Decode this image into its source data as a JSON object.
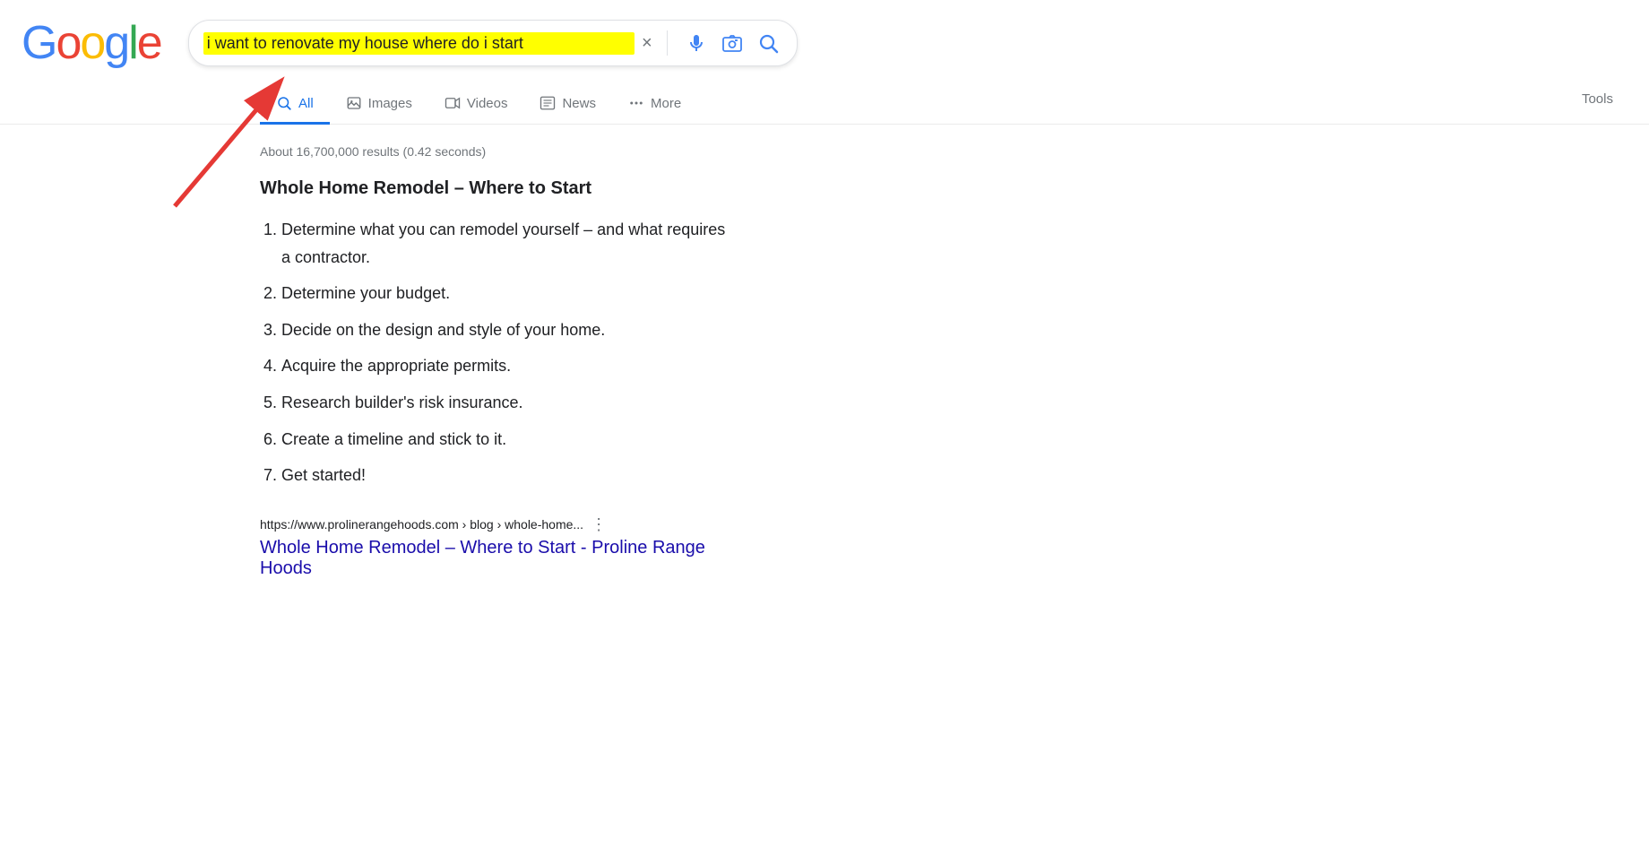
{
  "logo": {
    "letters": [
      "G",
      "o",
      "o",
      "g",
      "l",
      "e"
    ]
  },
  "search": {
    "query": "i want to renovate my house where do i start",
    "clear_label": "×",
    "placeholder": "Search"
  },
  "tabs": [
    {
      "id": "all",
      "label": "All",
      "active": true,
      "icon": "search"
    },
    {
      "id": "images",
      "label": "Images",
      "active": false,
      "icon": "image"
    },
    {
      "id": "videos",
      "label": "Videos",
      "active": false,
      "icon": "video"
    },
    {
      "id": "news",
      "label": "News",
      "active": false,
      "icon": "news"
    },
    {
      "id": "more",
      "label": "More",
      "active": false,
      "icon": "dots"
    }
  ],
  "tools_label": "Tools",
  "results_count": "About 16,700,000 results (0.42 seconds)",
  "featured_snippet": {
    "title": "Whole Home Remodel – Where to Start",
    "items": [
      "Determine what you can remodel yourself – and what requires a contractor.",
      "Determine your budget.",
      "Decide on the design and style of your home.",
      "Acquire the appropriate permits.",
      "Research builder's risk insurance.",
      "Create a timeline and stick to it.",
      "Get started!"
    ]
  },
  "result": {
    "url": "https://www.prolinerangehoods.com › blog › whole-home...",
    "link_text": "Whole Home Remodel – Where to Start - Proline Range Hoods"
  }
}
